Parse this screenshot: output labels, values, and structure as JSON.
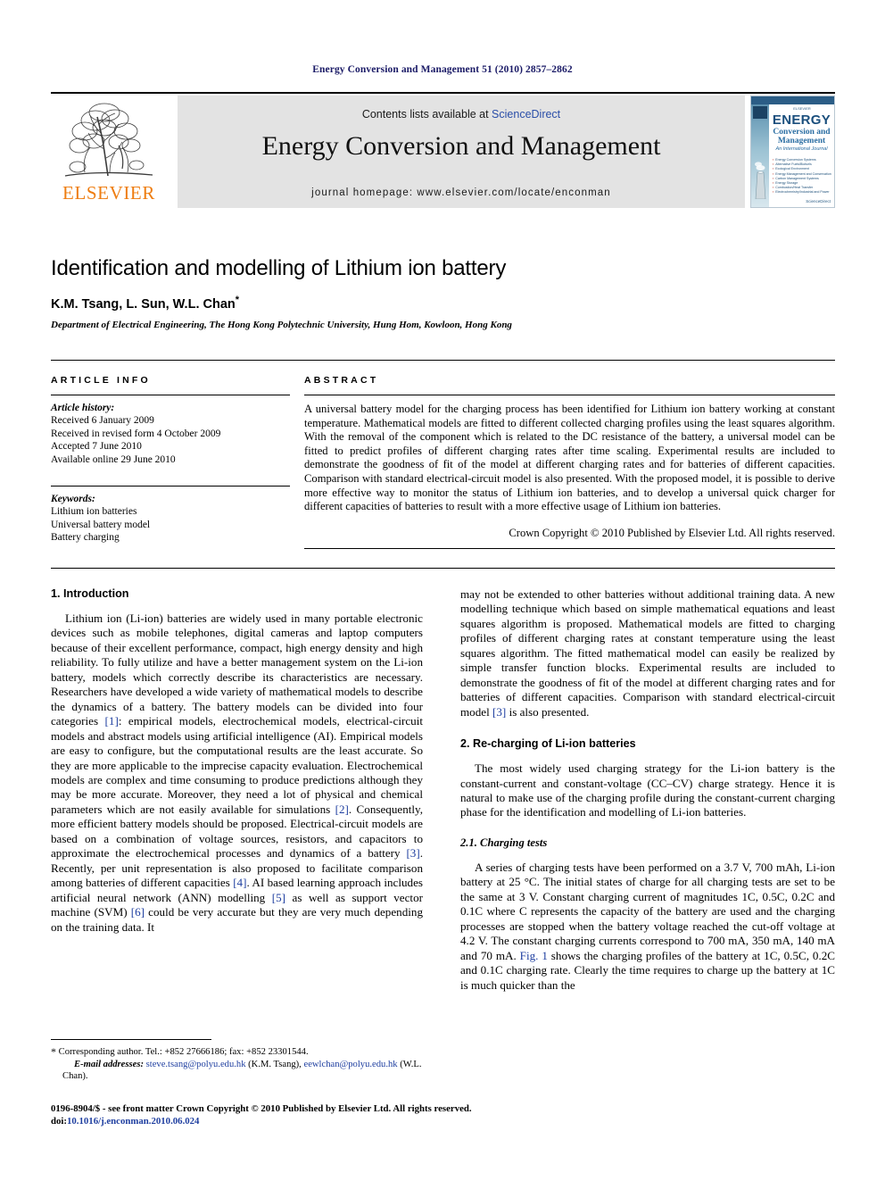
{
  "running_head": "Energy Conversion and Management 51 (2010) 2857–2862",
  "masthead": {
    "publisher_name": "ELSEVIER",
    "contents_prefix": "Contents lists available at ",
    "contents_link": "ScienceDirect",
    "journal_title": "Energy Conversion and Management",
    "homepage": "journal homepage: www.elsevier.com/locate/enconman",
    "cover": {
      "publisher_top": "ELSEVIER",
      "title": "ENERGY",
      "sub1": "Conversion and",
      "sub2": "Management",
      "sub3": "An International Journal",
      "topics": [
        "Energy Conversion Systems",
        "Alternative Fuels/Biofuels",
        "Ecological Environment",
        "Energy Management and Conservation",
        "Carbon Management Systems",
        "Energy Storage",
        "Combustion/Heat Transfer",
        "Electrochemistry/Industrial and Power"
      ],
      "footer": "ScienceDirect"
    }
  },
  "article": {
    "title": "Identification and modelling of Lithium ion battery",
    "authors": "K.M. Tsang, L. Sun, W.L. Chan",
    "corresponding_marker": "*",
    "affiliation": "Department of Electrical Engineering, The Hong Kong Polytechnic University, Hung Hom, Kowloon, Hong Kong"
  },
  "article_info": {
    "label": "ARTICLE INFO",
    "history_head": "Article history:",
    "history": [
      "Received 6 January 2009",
      "Received in revised form 4 October 2009",
      "Accepted 7 June 2010",
      "Available online 29 June 2010"
    ],
    "keywords_head": "Keywords:",
    "keywords": [
      "Lithium ion batteries",
      "Universal battery model",
      "Battery charging"
    ]
  },
  "abstract": {
    "label": "ABSTRACT",
    "text": "A universal battery model for the charging process has been identified for Lithium ion battery working at constant temperature. Mathematical models are fitted to different collected charging profiles using the least squares algorithm. With the removal of the component which is related to the DC resistance of the battery, a universal model can be fitted to predict profiles of different charging rates after time scaling. Experimental results are included to demonstrate the goodness of fit of the model at different charging rates and for batteries of different capacities. Comparison with standard electrical-circuit model is also presented. With the proposed model, it is possible to derive more effective way to monitor the status of Lithium ion batteries, and to develop a universal quick charger for different capacities of batteries to result with a more effective usage of Lithium ion batteries.",
    "copyright": "Crown Copyright © 2010 Published by Elsevier Ltd. All rights reserved."
  },
  "body": {
    "section1_heading": "1. Introduction",
    "intro_p1_a": "Lithium ion (Li-ion) batteries are widely used in many portable electronic devices such as mobile telephones, digital cameras and laptop computers because of their excellent performance, compact, high energy density and high reliability. To fully utilize and have a better management system on the Li-ion battery, models which correctly describe its characteristics are necessary. Researchers have developed a wide variety of mathematical models to describe the dynamics of a battery. The battery models can be divided into four categories ",
    "ref1": "[1]",
    "intro_p1_b": ": empirical models, electrochemical models, electrical-circuit models and abstract models using artificial intelligence (AI). Empirical models are easy to configure, but the computational results are the least accurate. So they are more applicable to the imprecise capacity evaluation. Electrochemical models are complex and time consuming to produce predictions although they may be more accurate. Moreover, they need a lot of physical and chemical parameters which are not easily available for simulations ",
    "ref2": "[2]",
    "intro_p1_c": ". Consequently, more efficient battery models should be proposed. Electrical-circuit models are based on a combination of voltage sources, resistors, and capacitors to approximate the electrochemical processes and dynamics of a battery ",
    "ref3": "[3]",
    "intro_p1_d": ". Recently, per unit representation is also proposed to facilitate comparison among batteries of different capacities ",
    "ref4": "[4]",
    "intro_p1_e": ". AI based learning approach includes artificial neural network (ANN) modelling ",
    "ref5": "[5]",
    "intro_p1_f": " as well as support vector machine (SVM) ",
    "ref6": "[6]",
    "intro_p1_g": " could be very accurate but they are very much depending on the training data. It ",
    "intro_p1_cont": "may not be extended to other batteries without additional training data. A new modelling technique which based on simple mathematical equations and least squares algorithm is proposed. Mathematical models are fitted to charging profiles of different charging rates at constant temperature using the least squares algorithm. The fitted mathematical model can easily be realized by simple transfer function blocks. Experimental results are included to demonstrate the goodness of fit of the model at different charging rates and for batteries of different capacities. Comparison with standard electrical-circuit model ",
    "ref3b": "[3]",
    "intro_p1_cont_b": " is also presented.",
    "section2_heading": "2. Re-charging of Li-ion batteries",
    "section2_p1": "The most widely used charging strategy for the Li-ion battery is the constant-current and constant-voltage (CC–CV) charge strategy. Hence it is natural to make use of the charging profile during the constant-current charging phase for the identification and modelling of Li-ion batteries.",
    "section21_heading": "2.1. Charging tests",
    "section21_p1_a": "A series of charging tests have been performed on a 3.7 V, 700 mAh, Li-ion battery at 25 °C. The initial states of charge for all charging tests are set to be the same at 3 V. Constant charging current of magnitudes 1C, 0.5C, 0.2C and 0.1C where C represents the capacity of the battery are used and the charging processes are stopped when the battery voltage reached the cut-off voltage at 4.2 V. The constant charging currents correspond to 700 mA, 350 mA, 140 mA and 70 mA. ",
    "figref": "Fig. 1",
    "section21_p1_b": " shows the charging profiles of the battery at 1C, 0.5C, 0.2C and 0.1C charging rate. Clearly the time requires to charge up the battery at 1C is much quicker than the"
  },
  "footnotes": {
    "corresponding": "Corresponding author. Tel.: +852 27666186; fax: +852 23301544.",
    "email_label": "E-mail addresses:",
    "email1": "steve.tsang@polyu.edu.hk",
    "email1_owner": "(K.M. Tsang),",
    "email2": "eewlchan@polyu.edu.hk",
    "email2_owner": "(W.L. Chan)."
  },
  "publication_footer": {
    "issn_line": "0196-8904/$ - see front matter Crown Copyright © 2010 Published by Elsevier Ltd. All rights reserved.",
    "doi_label": "doi:",
    "doi_value": "10.1016/j.enconman.2010.06.024"
  },
  "colors": {
    "running_head": "#1a1a66",
    "link": "#1f3fa0",
    "elsevier_orange": "#ee7d11",
    "banner_bg": "#e3e3e3",
    "cover_blue": "#1b4f7d"
  }
}
